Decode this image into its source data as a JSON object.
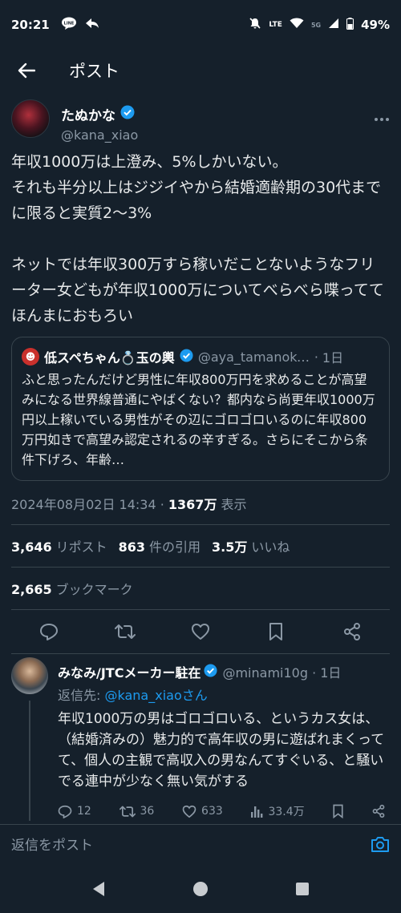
{
  "status": {
    "time": "20:21",
    "line_badge": "LINE",
    "network": "LTE",
    "network_small": "5G",
    "battery": "49%"
  },
  "header": {
    "title": "ポスト"
  },
  "post": {
    "author_name": "たぬかな",
    "handle": "@kana_xiao",
    "text": "年収1000万は上澄み、5%しかいない。\nそれも半分以上はジジイやから結婚適齢期の30代までに限ると実質2〜3%\n\nネットでは年収300万すら稼いだことないようなフリーター女どもが年収1000万についてべらべら喋っててほんまにおもろい",
    "quote": {
      "name": "低スペちゃん💍玉の輿",
      "handle": "@aya_tamanoko...",
      "dot": "·",
      "time": "1日",
      "text": "ふと思ったんだけど男性に年収800万円を求めることが高望みになる世界線普通にやばくない？都内なら尚更年収1000万円以上稼いでいる男性がその辺にゴロゴロいるのに年収800万円如きで高望み認定されるの辛すぎる。さらにそこから条件下げろ、年齢…"
    },
    "datetime": "2024年08月02日 14:34 · ",
    "views": "1367万",
    "views_label": " 表示",
    "stats": {
      "reposts": "3,646",
      "reposts_label": "リポスト",
      "quotes": "863",
      "quotes_label": "件の引用",
      "likes": "3.5万",
      "likes_label": "いいね",
      "bookmarks": "2,665",
      "bookmarks_label": "ブックマーク"
    }
  },
  "reply": {
    "name": "みなみ/JTCメーカー駐在",
    "handle": "@minami10g · 1日",
    "reply_to_prefix": "返信先: ",
    "reply_to_user": "@kana_xiaoさん",
    "text": "年収1000万の男はゴロゴロいる、というカス女は、（結婚済みの）魅力的で高年収の男に遊ばれまくってて、個人の主観で高収入の男なんてすぐいる、と騒いでる連中が少なく無い気がする",
    "replies": "12",
    "reposts": "36",
    "likes": "633",
    "views": "33.4万"
  },
  "compose": {
    "placeholder": "返信をポスト"
  },
  "colors": {
    "background": "#15202b",
    "accent": "#1d9bf0",
    "muted": "#8b98a5"
  }
}
